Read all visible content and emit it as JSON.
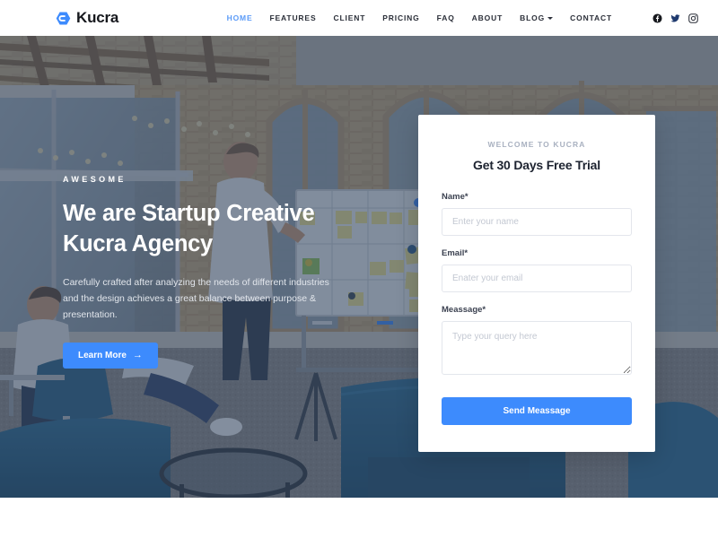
{
  "navbar": {
    "brand": {
      "text": "Kucra",
      "icon": "hexagon-logo-icon",
      "color": "#3d8bfd"
    },
    "links": [
      {
        "label": "HOME",
        "active": true
      },
      {
        "label": "FEATURES",
        "active": false
      },
      {
        "label": "CLIENT",
        "active": false
      },
      {
        "label": "PRICING",
        "active": false
      },
      {
        "label": "FAQ",
        "active": false
      },
      {
        "label": "ABOUT",
        "active": false
      },
      {
        "label": "BLOG",
        "active": false,
        "dropdown": true
      },
      {
        "label": "CONTACT",
        "active": false
      }
    ],
    "socials": [
      {
        "name": "facebook-icon"
      },
      {
        "name": "twitter-icon"
      },
      {
        "name": "instagram-icon"
      }
    ],
    "active_color": "#5b9bf8"
  },
  "hero": {
    "eyebrow": "AWESOME",
    "title_line1": "We are Startup Creative",
    "title_line2": "Kucra Agency",
    "paragraph": "Carefully crafted after analyzing the needs of different industries and the design achieves a great balance between purpose & presentation.",
    "cta_label": "Learn More",
    "cta_arrow": "→",
    "cta_color": "#3d8bfd",
    "background": "office interior with exposed brick, wood beams, whiteboard with sticky notes, people at desks and blue sofa chairs",
    "overlay_color": "#2c3e5a"
  },
  "form": {
    "eyebrow": "WELCOME TO KUCRA",
    "title": "Get 30 Days Free Trial",
    "fields": [
      {
        "label": "Name*",
        "placeholder": "Enter your name",
        "value": ""
      },
      {
        "label": "Email*",
        "placeholder": "Enater your email",
        "value": ""
      },
      {
        "label": "Meassage*",
        "placeholder": "Type your query here",
        "value": ""
      }
    ],
    "submit_label": "Send Meassage",
    "submit_color": "#3d8bfd"
  }
}
